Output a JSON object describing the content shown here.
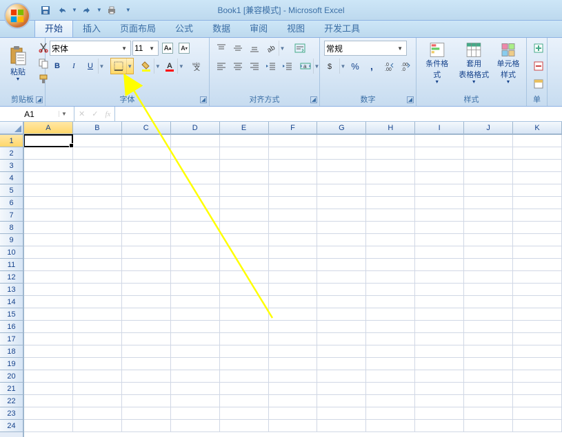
{
  "titlebar": {
    "title": "Book1  [兼容模式] - Microsoft Excel"
  },
  "tabs": [
    "开始",
    "插入",
    "页面布局",
    "公式",
    "数据",
    "审阅",
    "视图",
    "开发工具"
  ],
  "activeTab": "开始",
  "ribbon": {
    "clipboard": {
      "label": "剪贴板",
      "paste": "粘贴"
    },
    "font": {
      "label": "字体",
      "fontname": "宋体",
      "fontsize": "11",
      "bold": "B",
      "italic": "I",
      "underline": "U"
    },
    "alignment": {
      "label": "对齐方式"
    },
    "number": {
      "label": "数字",
      "format": "常规"
    },
    "styles": {
      "label": "样式",
      "cond": "条件格式",
      "table": "套用\n表格格式",
      "cell": "单元格\n样式"
    },
    "cells": {
      "label": "单"
    }
  },
  "formulaBar": {
    "namebox": "A1",
    "fx": "fx",
    "content": ""
  },
  "grid": {
    "columns": [
      "A",
      "B",
      "C",
      "D",
      "E",
      "F",
      "G",
      "H",
      "I",
      "J",
      "K"
    ],
    "rows": [
      1,
      2,
      3,
      4,
      5,
      6,
      7,
      8,
      9,
      10,
      11,
      12,
      13,
      14,
      15,
      16,
      17,
      18,
      19,
      20,
      21,
      22,
      23,
      24
    ],
    "activeCell": "A1"
  }
}
